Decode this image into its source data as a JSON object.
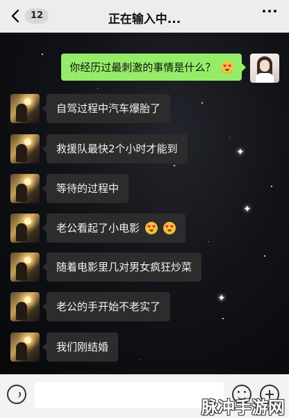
{
  "header": {
    "back_icon": "chevron-left-icon",
    "unread_count": "12",
    "title": "正在输入中...",
    "more_icon": "more-dots-icon"
  },
  "messages": [
    {
      "side": "right",
      "text": "你经历过最刺激的事情是什么？",
      "emoji": "heart-eyes"
    },
    {
      "side": "left",
      "text": "自驾过程中汽车爆胎了"
    },
    {
      "side": "left",
      "text": "救援队最快2个小时才能到"
    },
    {
      "side": "left",
      "text": "等待的过程中"
    },
    {
      "side": "left",
      "text": "老公看起了小电影",
      "emoji": "heart-eyes x2"
    },
    {
      "side": "left",
      "text": "随着电影里几对男女疯狂炒菜"
    },
    {
      "side": "left",
      "text": "老公的手开始不老实了"
    },
    {
      "side": "left",
      "text": "我们刚结婚"
    }
  ],
  "input_bar": {
    "voice_icon": "voice-icon",
    "input_value": "",
    "emoji_icon": "smiley-icon",
    "plus_icon": "plus-icon"
  },
  "watermark": "脉冲手游网",
  "colors": {
    "sent_bubble": "#95ec69",
    "received_bubble": "#2c2c2c",
    "header_bg": "#ededed",
    "chat_bg": "#0b0b0d"
  }
}
